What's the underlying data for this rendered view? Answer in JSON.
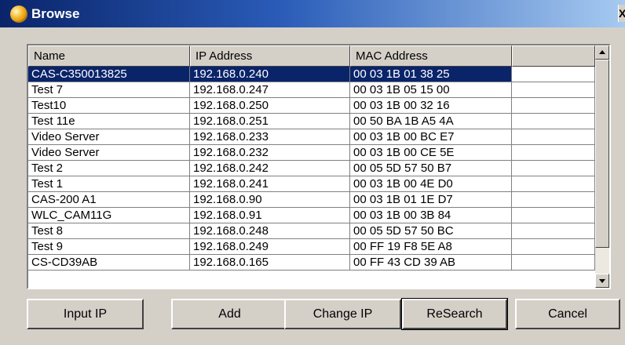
{
  "window": {
    "title": "Browse",
    "close_glyph": "X"
  },
  "list": {
    "columns": [
      "Name",
      "IP Address",
      "MAC Address",
      ""
    ],
    "selected_index": 0,
    "rows": [
      {
        "name": "CAS-C350013825",
        "ip": "192.168.0.240",
        "mac": "00 03 1B 01 38 25"
      },
      {
        "name": "Test 7",
        "ip": "192.168.0.247",
        "mac": "00 03 1B 05 15 00"
      },
      {
        "name": "Test10",
        "ip": "192.168.0.250",
        "mac": "00 03 1B 00 32 16"
      },
      {
        "name": "Test 11e",
        "ip": "192.168.0.251",
        "mac": "00 50 BA 1B A5 4A"
      },
      {
        "name": "Video Server",
        "ip": "192.168.0.233",
        "mac": "00 03 1B 00 BC E7"
      },
      {
        "name": "Video Server",
        "ip": "192.168.0.232",
        "mac": "00 03 1B 00 CE 5E"
      },
      {
        "name": "Test 2",
        "ip": "192.168.0.242",
        "mac": "00 05 5D 57 50 B7"
      },
      {
        "name": "Test 1",
        "ip": "192.168.0.241",
        "mac": "00 03 1B 00 4E D0"
      },
      {
        "name": "CAS-200 A1",
        "ip": "192.168.0.90",
        "mac": "00 03 1B 01 1E D7"
      },
      {
        "name": "WLC_CAM11G",
        "ip": "192.168.0.91",
        "mac": "00 03 1B 00 3B 84"
      },
      {
        "name": "Test 8",
        "ip": "192.168.0.248",
        "mac": "00 05 5D 57 50 BC"
      },
      {
        "name": "Test 9",
        "ip": "192.168.0.249",
        "mac": "00 FF 19 F8 5E A8"
      },
      {
        "name": "CS-CD39AB",
        "ip": "192.168.0.165",
        "mac": "00 FF 43 CD 39 AB"
      }
    ]
  },
  "buttons": {
    "input_ip": "Input IP",
    "add": "Add",
    "change_ip": "Change IP",
    "research": "ReSearch",
    "cancel": "Cancel"
  },
  "colors": {
    "selection": "#0a246a",
    "face": "#d4d0c8"
  },
  "icons": {
    "title": "browse-globe-icon",
    "scroll_up": "scroll-up-arrow-icon",
    "scroll_down": "scroll-down-arrow-icon"
  }
}
